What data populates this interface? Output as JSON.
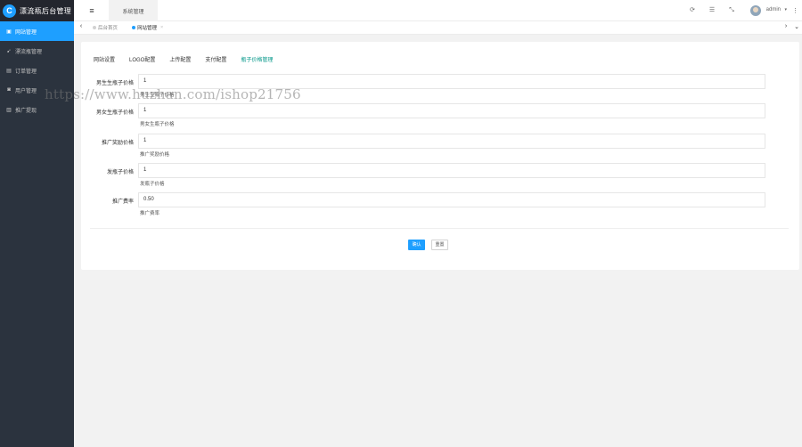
{
  "app": {
    "logo_mark": "C",
    "title": "漂流瓶后台管理"
  },
  "sidebar": {
    "items": [
      {
        "label": "网站管理",
        "icon": "home-icon",
        "glyph": "▣",
        "active": true
      },
      {
        "label": "漂流瓶管理",
        "icon": "send-icon",
        "glyph": "➹",
        "active": false
      },
      {
        "label": "订单管理",
        "icon": "calendar-icon",
        "glyph": "▤",
        "active": false
      },
      {
        "label": "用户管理",
        "icon": "user-icon",
        "glyph": "◙",
        "active": false
      },
      {
        "label": "推广提现",
        "icon": "wallet-icon",
        "glyph": "▥",
        "active": false
      }
    ]
  },
  "header": {
    "menu_glyph": "≡",
    "tab_label": "系统管理",
    "refresh_glyph": "⟳",
    "note_glyph": "☰",
    "fullscreen_glyph": "⤡",
    "username": "admin",
    "caret": "▾",
    "more": "⋮"
  },
  "tabsbar": {
    "prev": "‹",
    "next": "›",
    "close_all": "⌄",
    "tabs": [
      {
        "label": "后台首页",
        "active": false
      },
      {
        "label": "网站管理",
        "active": true,
        "close": "×"
      }
    ]
  },
  "settings": {
    "tabs": [
      "网站设置",
      "LOGO配置",
      "上传配置",
      "支付配置",
      "瓶子价格管理"
    ],
    "active_tab": 4,
    "fields": [
      {
        "label": "男生生瓶子价格",
        "value": "1",
        "tip": "男生生瓶子价格"
      },
      {
        "label": "男女生瓶子价格",
        "value": "1",
        "tip": "男女生瓶子价格"
      },
      {
        "label": "推广奖励价格",
        "value": "1",
        "tip": "推广奖励价格"
      },
      {
        "label": "发瓶子价格",
        "value": "1",
        "tip": "发瓶子价格"
      },
      {
        "label": "推广费率",
        "value": "0.50",
        "tip": "推广费率"
      }
    ],
    "submit_label": "确认",
    "reset_label": "重置"
  },
  "watermark": "https://www.huzhan.com/ishop21756",
  "colors": {
    "accent": "#1e9fff",
    "active_tab": "#009688",
    "sidebar_bg": "#2b333e"
  }
}
